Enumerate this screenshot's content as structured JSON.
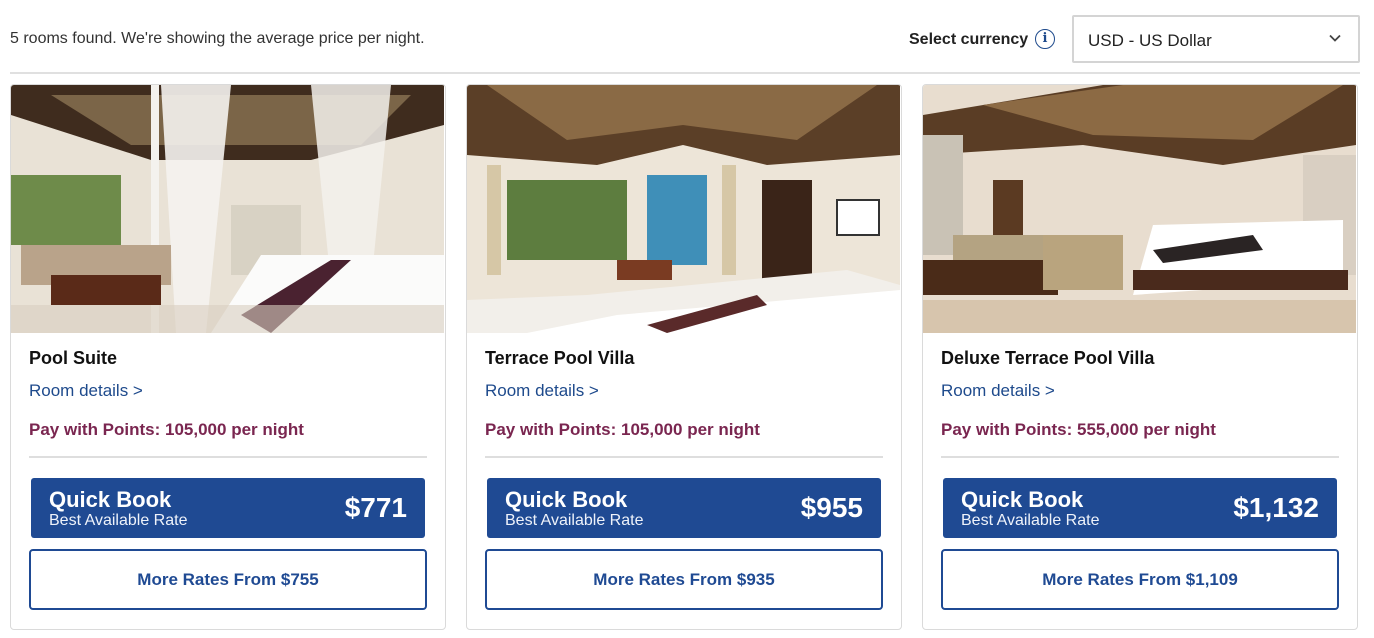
{
  "summary": "5 rooms found. We're showing the average price per night.",
  "currency": {
    "label": "Select currency",
    "info_icon": "info-icon",
    "selected": "USD - US Dollar",
    "dropdown_icon": "chevron-down-icon"
  },
  "rooms": [
    {
      "name": "Pool Suite",
      "details_link": "Room details >",
      "points": "Pay with Points: 105,000 per night",
      "quick_book_title": "Quick Book",
      "quick_book_sub": "Best Available Rate",
      "quick_book_price": "$771",
      "more_rates": "More Rates From $755"
    },
    {
      "name": "Terrace Pool Villa",
      "details_link": "Room details >",
      "points": "Pay with Points: 105,000 per night",
      "quick_book_title": "Quick Book",
      "quick_book_sub": "Best Available Rate",
      "quick_book_price": "$955",
      "more_rates": "More Rates From $935"
    },
    {
      "name": "Deluxe Terrace Pool Villa",
      "details_link": "Room details >",
      "points": "Pay with Points: 555,000 per night",
      "quick_book_title": "Quick Book",
      "quick_book_sub": "Best Available Rate",
      "quick_book_price": "$1,132",
      "more_rates": "More Rates From $1,109"
    }
  ],
  "colors": {
    "brand_blue": "#1f4a93",
    "points_text": "#7a2650",
    "link_text": "#1e4a8c"
  }
}
